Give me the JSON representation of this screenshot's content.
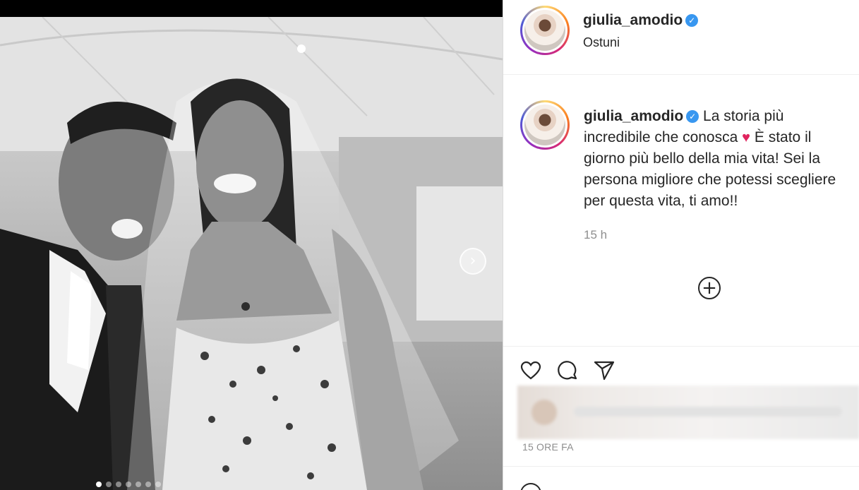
{
  "post": {
    "username": "giulia_amodio",
    "location": "Ostuni",
    "caption_lines": [
      "La storia più",
      "incredibile che conosca",
      "È stato il",
      "giorno più bello della mia vita! Sei la",
      "persona migliore che potessi scegliere",
      "per questa vita, ti amo!!"
    ],
    "caption_time": "15 h",
    "posted_ago": "15 ORE FA",
    "carousel": {
      "total_slides": 7,
      "active_index": 0
    }
  },
  "icons": {
    "verified": "verified-badge-icon",
    "heart_emoji": "red-heart-emoji",
    "next": "chevron-right-icon",
    "load_more": "plus-circle-icon",
    "like": "heart-outline-icon",
    "comment": "comment-bubble-icon",
    "share": "paper-plane-icon"
  },
  "glyphs": {
    "verified": "✓",
    "next": "›",
    "load_more": "+",
    "heart_emoji": "♥"
  },
  "colors": {
    "verified_blue": "#3897f0",
    "heart_red": "#e0245e",
    "meta_gray": "#8e8e8e",
    "text": "#262626"
  }
}
